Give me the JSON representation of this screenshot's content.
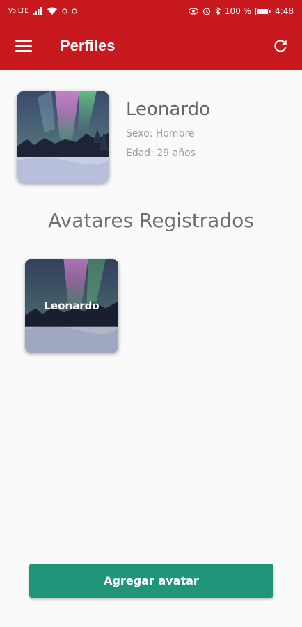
{
  "status_bar": {
    "carrier_small": "Vo LTE",
    "battery": "100 %",
    "time": "4:48"
  },
  "app_bar": {
    "title": "Perfiles",
    "menu_icon": "menu-icon",
    "refresh_icon": "refresh-icon"
  },
  "profile": {
    "name": "Leonardo",
    "sex": "Sexo: Hombre",
    "age": "Edad: 29 años"
  },
  "section": {
    "title": "Avatares Registrados"
  },
  "avatars": [
    {
      "label": "Leonardo"
    }
  ],
  "actions": {
    "add_avatar": "Agregar avatar"
  },
  "colors": {
    "primary": "#c8191f",
    "accent": "#1f957a",
    "background": "#fafafa"
  }
}
